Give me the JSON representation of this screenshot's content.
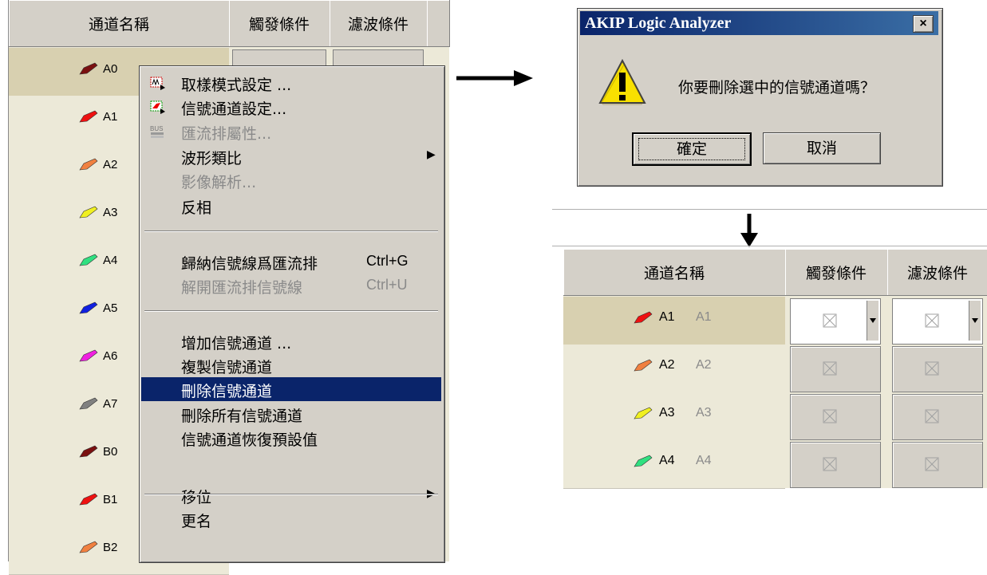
{
  "left_table": {
    "headers": [
      "通道名稱",
      "觸發條件",
      "濾波條件"
    ],
    "rows": [
      {
        "name": "A0",
        "color": "#7a1010"
      },
      {
        "name": "A1",
        "color": "#ee1111"
      },
      {
        "name": "A2",
        "color": "#f08040"
      },
      {
        "name": "A3",
        "color": "#f0f020"
      },
      {
        "name": "A4",
        "color": "#30e080"
      },
      {
        "name": "A5",
        "color": "#1020e0"
      },
      {
        "name": "A6",
        "color": "#f020e0"
      },
      {
        "name": "A7",
        "color": "#808080"
      },
      {
        "name": "B0",
        "color": "#7a1010"
      },
      {
        "name": "B1",
        "color": "#ee1111"
      },
      {
        "name": "B2",
        "color": "#f08040"
      }
    ]
  },
  "context_menu": {
    "items": [
      {
        "label": "取樣模式設定 ...",
        "icon": "sampling-icon"
      },
      {
        "label": "信號通道設定...",
        "icon": "channel-settings-icon"
      },
      {
        "label": "匯流排屬性...",
        "icon": "bus-icon",
        "disabled": true
      },
      {
        "label": "波形類比",
        "submenu": true
      },
      {
        "label": "影像解析...",
        "disabled": true
      },
      {
        "label": "反相"
      },
      {
        "label": "歸納信號線爲匯流排",
        "shortcut": "Ctrl+G"
      },
      {
        "label": "解開匯流排信號線",
        "shortcut": "Ctrl+U",
        "disabled": true
      },
      {
        "label": "增加信號通道 ..."
      },
      {
        "label": "複製信號通道"
      },
      {
        "label": "刪除信號通道",
        "highlighted": true
      },
      {
        "label": "刪除所有信號通道"
      },
      {
        "label": "信號通道恢復預設值"
      },
      {
        "label": "移位",
        "submenu": true
      },
      {
        "label": "更名"
      }
    ]
  },
  "dialog": {
    "title": "AKIP Logic Analyzer",
    "close_label": "×",
    "message": "你要刪除選中的信號通道嗎？",
    "ok_label": "確定",
    "cancel_label": "取消",
    "icon": "warning-icon"
  },
  "result_table": {
    "headers": [
      "通道名稱",
      "觸發條件",
      "濾波條件"
    ],
    "rows": [
      {
        "name": "A1",
        "alias": "A1",
        "color": "#ee1111",
        "selected": true
      },
      {
        "name": "A2",
        "alias": "A2",
        "color": "#f08040"
      },
      {
        "name": "A3",
        "alias": "A3",
        "color": "#f0f020"
      },
      {
        "name": "A4",
        "alias": "A4",
        "color": "#30e080"
      }
    ]
  }
}
